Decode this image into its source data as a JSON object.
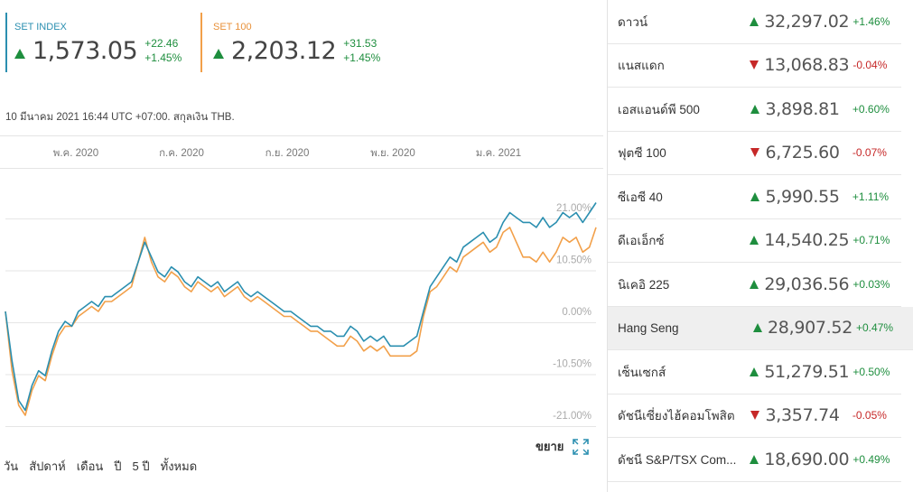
{
  "quotes": [
    {
      "label": "SET INDEX",
      "value": "1,573.05",
      "change": "+22.46",
      "percent": "+1.45%",
      "direction": "up",
      "color": "#2b8fb0"
    },
    {
      "label": "SET 100",
      "value": "2,203.12",
      "change": "+31.53",
      "percent": "+1.45%",
      "direction": "up",
      "color": "#f2a04a"
    }
  ],
  "timestamp": "10 มีนาคม 2021 16:44 UTC +07:00. สกุลเงิน THB.",
  "expand_label": "ขยาย",
  "ranges": [
    "วัน",
    "สัปดาห์",
    "เดือน",
    "ปี",
    "5 ปี",
    "ทั้งหมด"
  ],
  "chart_data": {
    "type": "line",
    "x_ticks": [
      "พ.ค. 2020",
      "ก.ค. 2020",
      "ก.ย. 2020",
      "พ.ย. 2020",
      "ม.ค. 2021"
    ],
    "y_ticks": [
      "21.00%",
      "10.50%",
      "0.00%",
      "-10.50%",
      "-21.00%"
    ],
    "ylim": [
      -21,
      21
    ],
    "y_unit": "%",
    "grid": true,
    "series": [
      {
        "name": "SET INDEX",
        "color": "#2b8fb0",
        "values": [
          0,
          -10,
          -18,
          -20,
          -15,
          -12,
          -13,
          -8,
          -4,
          -2,
          -3,
          0,
          1,
          2,
          1,
          3,
          3,
          4,
          5,
          6,
          10,
          14,
          11,
          8,
          7,
          9,
          8,
          6,
          5,
          7,
          6,
          5,
          6,
          4,
          5,
          6,
          4,
          3,
          4,
          3,
          2,
          1,
          0,
          0,
          -1,
          -2,
          -3,
          -3,
          -4,
          -4,
          -5,
          -5,
          -3,
          -4,
          -6,
          -5,
          -6,
          -5,
          -7,
          -7,
          -7,
          -6,
          -5,
          0,
          5,
          7,
          9,
          11,
          10,
          13,
          14,
          15,
          16,
          14,
          15,
          18,
          20,
          19,
          18,
          18,
          17,
          19,
          17,
          18,
          20,
          19,
          20,
          18,
          20,
          22
        ]
      },
      {
        "name": "SET 100",
        "color": "#f2a04a",
        "values": [
          0,
          -12,
          -19,
          -21,
          -16,
          -13,
          -14,
          -9,
          -5,
          -3,
          -3,
          -1,
          0,
          1,
          0,
          2,
          2,
          3,
          4,
          5,
          10,
          15,
          10,
          7,
          6,
          8,
          7,
          5,
          4,
          6,
          5,
          4,
          5,
          3,
          4,
          5,
          3,
          2,
          3,
          2,
          1,
          0,
          -1,
          -1,
          -2,
          -3,
          -4,
          -4,
          -5,
          -6,
          -7,
          -7,
          -5,
          -6,
          -8,
          -7,
          -8,
          -7,
          -9,
          -9,
          -9,
          -9,
          -8,
          -1,
          4,
          5,
          7,
          9,
          8,
          11,
          12,
          13,
          14,
          12,
          13,
          16,
          17,
          14,
          11,
          11,
          10,
          12,
          10,
          12,
          15,
          14,
          15,
          12,
          13,
          17
        ]
      }
    ]
  },
  "markets": [
    {
      "name": "ดาวน์",
      "value": "32,297.02",
      "change": "+1.46%",
      "direction": "up"
    },
    {
      "name": "แนสแดก",
      "value": "13,068.83",
      "change": "-0.04%",
      "direction": "down"
    },
    {
      "name": "เอสแอนด์พี 500",
      "value": "3,898.81",
      "change": "+0.60%",
      "direction": "up"
    },
    {
      "name": "ฟุตซี 100",
      "value": "6,725.60",
      "change": "-0.07%",
      "direction": "down"
    },
    {
      "name": "ซีเอซี 40",
      "value": "5,990.55",
      "change": "+1.11%",
      "direction": "up"
    },
    {
      "name": "ดีเอเอ็กซ์",
      "value": "14,540.25",
      "change": "+0.71%",
      "direction": "up"
    },
    {
      "name": "นิเคอิ 225",
      "value": "29,036.56",
      "change": "+0.03%",
      "direction": "up"
    },
    {
      "name": "Hang Seng",
      "value": "28,907.52",
      "change": "+0.47%",
      "direction": "up",
      "highlighted": true
    },
    {
      "name": "เซ็นเซกส์",
      "value": "51,279.51",
      "change": "+0.50%",
      "direction": "up"
    },
    {
      "name": "ดัชนีเซี่ยงไฮ้คอมโพสิต",
      "value": "3,357.74",
      "change": "-0.05%",
      "direction": "down"
    },
    {
      "name": "ดัชนี S&P/TSX Com...",
      "value": "18,690.00",
      "change": "+0.49%",
      "direction": "up"
    }
  ]
}
